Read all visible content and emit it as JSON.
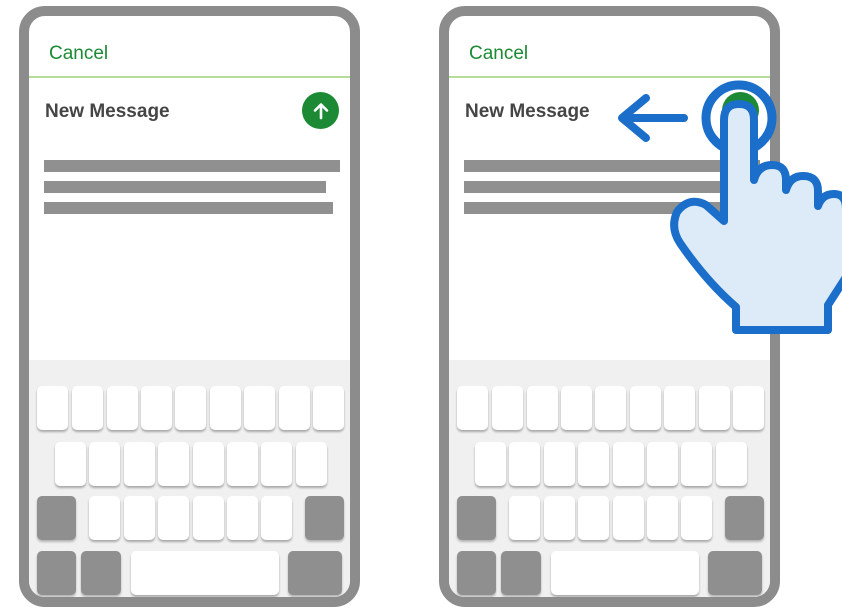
{
  "compose": {
    "cancel_label": "Cancel",
    "title": "New Message"
  },
  "icons": {
    "send": "up-arrow-icon",
    "hand": "pointing-hand-icon",
    "swipe": "left-arrow-icon"
  },
  "colors": {
    "accent": "#1c8a34",
    "header_divider": "#b5dc98",
    "frame": "#8c8c8c",
    "gesture": "#1b6ec9",
    "hand_fill": "#dcebf7"
  }
}
